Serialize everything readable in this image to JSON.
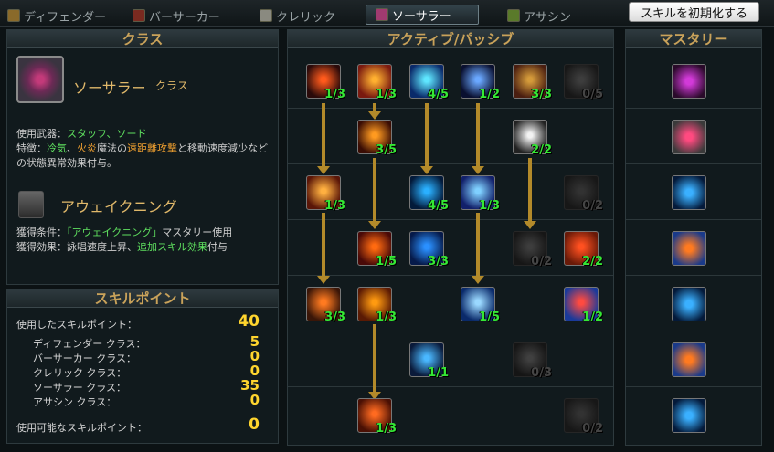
{
  "tabs": [
    {
      "label": "ディフェンダー",
      "icon": "defender-class-icon",
      "active": false
    },
    {
      "label": "バーサーカー",
      "icon": "berserker-class-icon",
      "active": false
    },
    {
      "label": "クレリック",
      "icon": "cleric-class-icon",
      "active": false
    },
    {
      "label": "ソーサラー",
      "icon": "sorcerer-class-icon",
      "active": true
    },
    {
      "label": "アサシン",
      "icon": "assassin-class-icon",
      "active": false
    }
  ],
  "reset_button": "スキルを初期化する",
  "class_panel": {
    "header": "クラス",
    "class_name": "ソーサラー",
    "class_suffix": "クラス",
    "weapons_label": "使用武器：",
    "weapons_value": "スタッフ、ソード",
    "feature_label": "特徴：",
    "feature_part1": "冷気",
    "feature_sep": "、",
    "feature_part2": "火炎",
    "feature_part3": "魔法の",
    "feature_part4": "遠距離攻撃",
    "feature_part5": "と移動速度減少などの状態異常効果付与。",
    "awakening_name": "アウェイクニング",
    "cond_label": "獲得条件：",
    "cond_value": "「アウェイクニング」",
    "cond_rest": "マスタリー使用",
    "effect_label": "獲得効果：",
    "effect_value1": "詠唱速度上昇、",
    "effect_value2": "追加スキル効果",
    "effect_value3": "付与"
  },
  "skill_points": {
    "header": "スキルポイント",
    "used_label": "使用したスキルポイント：",
    "used_value": "40",
    "rows": [
      {
        "label": "ディフェンダー クラス：",
        "value": "5"
      },
      {
        "label": "バーサーカー クラス：",
        "value": "0"
      },
      {
        "label": "クレリック クラス：",
        "value": "0"
      },
      {
        "label": "ソーサラー クラス：",
        "value": "35"
      },
      {
        "label": "アサシン クラス：",
        "value": "0"
      }
    ],
    "available_label": "使用可能なスキルポイント：",
    "available_value": "0"
  },
  "skill_tree_header": "アクティブ/パッシブ",
  "mastery_header": "マスタリー",
  "skills": [
    {
      "name": "meteor-skill",
      "level": "1/3",
      "c1": "#ff5a1c",
      "c2": "#2a0a0a",
      "locked": false
    },
    {
      "name": "explosion-skill",
      "level": "1/3",
      "c1": "#ffb030",
      "c2": "#7a1a10",
      "locked": false
    },
    {
      "name": "ice-shard-skill",
      "level": "4/5",
      "c1": "#5fe6ff",
      "c2": "#0a2a6a",
      "locked": false
    },
    {
      "name": "ice-comet-skill",
      "level": "1/2",
      "c1": "#6aa8ff",
      "c2": "#0a1030",
      "locked": false
    },
    {
      "name": "spellbook-skill",
      "level": "3/3",
      "c1": "#d49a3a",
      "c2": "#4a1e10",
      "locked": false
    },
    {
      "name": "locked-skill-r1",
      "level": "0/5",
      "c1": "#888888",
      "c2": "#333333",
      "locked": true
    },
    {
      "name": "fire-wave-skill",
      "level": "3/5",
      "c1": "#ff9a20",
      "c2": "#3a0d04",
      "locked": false
    },
    {
      "name": "phantom-skill",
      "level": "2/2",
      "c1": "#f2f2f2",
      "c2": "#222222",
      "locked": false
    },
    {
      "name": "fire-bolt-skill",
      "level": "1/3",
      "c1": "#ffb040",
      "c2": "#5a1608",
      "locked": false
    },
    {
      "name": "frost-ring-skill",
      "level": "4/5",
      "c1": "#2ab0ff",
      "c2": "#031a3a",
      "locked": false
    },
    {
      "name": "glacial-wave-skill",
      "level": "1/3",
      "c1": "#7fd0ff",
      "c2": "#12206a",
      "locked": false
    },
    {
      "name": "locked-skill-r3",
      "level": "0/2",
      "c1": "#8a6a60",
      "c2": "#333333",
      "locked": true
    },
    {
      "name": "inferno-skill",
      "level": "1/5",
      "c1": "#ff6a10",
      "c2": "#4a0a08",
      "locked": false
    },
    {
      "name": "ice-barrier-skill",
      "level": "3/3",
      "c1": "#2a90ff",
      "c2": "#061a4a",
      "locked": false
    },
    {
      "name": "locked-skill-r4",
      "level": "0/2",
      "c1": "#7a8a8a",
      "c2": "#2a3333",
      "locked": true
    },
    {
      "name": "flame-swirl-skill",
      "level": "2/2",
      "c1": "#ff5020",
      "c2": "#6a1a08",
      "locked": false
    },
    {
      "name": "fire-storm-skill",
      "level": "3/3",
      "c1": "#ff7a20",
      "c2": "#3a1608",
      "locked": false
    },
    {
      "name": "fire-wheel-skill",
      "level": "1/3",
      "c1": "#ff9a10",
      "c2": "#5a1a04",
      "locked": false
    },
    {
      "name": "blizzard-skill",
      "level": "1/5",
      "c1": "#9ad8ff",
      "c2": "#0a2a6a",
      "locked": false
    },
    {
      "name": "elemental-swirl-skill",
      "level": "1/2",
      "c1": "#ff4a40",
      "c2": "#1a3a9a",
      "locked": false
    },
    {
      "name": "crystal-skill",
      "level": "1/1",
      "c1": "#4ab8ff",
      "c2": "#0a1a3a",
      "locked": false
    },
    {
      "name": "locked-skill-r6",
      "level": "0/3",
      "c1": "#6a9a7a",
      "c2": "#223322",
      "locked": true
    },
    {
      "name": "flame-pot-skill",
      "level": "1/3",
      "c1": "#ff6a20",
      "c2": "#4a1004",
      "locked": false
    },
    {
      "name": "locked-skill-r7",
      "level": "0/2",
      "c1": "#8a6a60",
      "c2": "#333333",
      "locked": true
    }
  ],
  "masteries": [
    {
      "name": "mastery-awakening",
      "c1": "#d23ad8",
      "c2": "#2a0a2a"
    },
    {
      "name": "mastery-eye",
      "c1": "#ff4a80",
      "c2": "#3a3a3a"
    },
    {
      "name": "mastery-ice",
      "c1": "#3ab0ff",
      "c2": "#041a3a"
    },
    {
      "name": "mastery-fire-ice-1",
      "c1": "#ff7a20",
      "c2": "#1a3a8a"
    },
    {
      "name": "mastery-ice-2",
      "c1": "#3ab0ff",
      "c2": "#041a3a"
    },
    {
      "name": "mastery-fire-ice-2",
      "c1": "#ff7a20",
      "c2": "#1a3a8a"
    },
    {
      "name": "mastery-ice-3",
      "c1": "#3ab0ff",
      "c2": "#041a3a"
    }
  ]
}
